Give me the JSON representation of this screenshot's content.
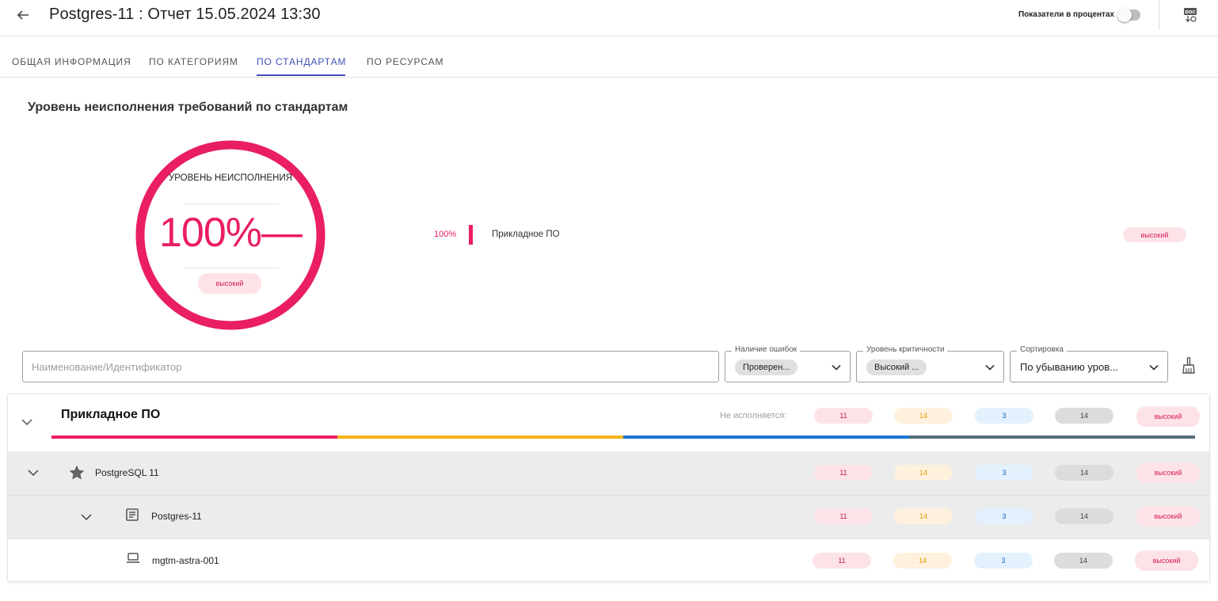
{
  "header": {
    "title": "Postgres-11 : Отчет 15.05.2024 13:30",
    "percent_toggle_label": "Показатели в процентах"
  },
  "tabs": [
    {
      "label": "ОБЩАЯ ИНФОРМАЦИЯ"
    },
    {
      "label": "ПО КАТЕГОРИЯМ"
    },
    {
      "label": "ПО СТАНДАРТАМ",
      "active": true
    },
    {
      "label": "ПО РЕСУРСАМ"
    }
  ],
  "section_title": "Уровень неисполнения требований по стандартам",
  "gauge": {
    "label": "УРОВЕНЬ НЕИСПОЛНЕНИЯ",
    "value": "100%—",
    "level": 1.0,
    "badge": "высокий",
    "color": "#e91e63"
  },
  "legend": {
    "percent": "100%",
    "name": "Прикладное ПО",
    "badge": "высокий"
  },
  "filters": {
    "search_placeholder": "Наименование/Идентификатор",
    "errors": {
      "label": "Наличие ошибок",
      "chip": "Проверен..."
    },
    "criticality": {
      "label": "Уровень критичности",
      "chip": "Высокий ..."
    },
    "sort": {
      "label": "Сортировка",
      "value": "По убыванию уров..."
    }
  },
  "table": {
    "group": {
      "title": "Прикладное ПО",
      "not_done_label": "Не исполняется:",
      "counts": [
        "11",
        "14",
        "3",
        "14"
      ],
      "risk": "высокий",
      "stripe_colors": [
        "#e91e63",
        "#f2b418",
        "#1976d2",
        "#546e7a"
      ]
    },
    "rows": [
      {
        "name": "PostgreSQL 11",
        "icon": "star-icon",
        "counts": [
          "11",
          "14",
          "3",
          "14"
        ],
        "risk": "высокий"
      },
      {
        "name": "Postgres-11",
        "icon": "document-icon",
        "counts": [
          "11",
          "14",
          "3",
          "14"
        ],
        "risk": "высокий"
      },
      {
        "name": "mgtm-astra-001",
        "icon": "laptop-icon",
        "counts": [
          "11",
          "14",
          "3",
          "14"
        ],
        "risk": "высокий"
      }
    ]
  }
}
